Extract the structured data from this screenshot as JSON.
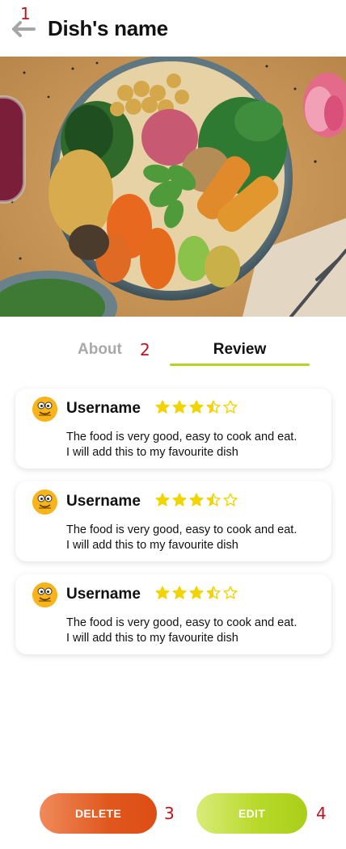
{
  "annotations": [
    "1",
    "2",
    "3",
    "4"
  ],
  "header": {
    "title": "Dish's name",
    "back_icon": "arrow-left-icon"
  },
  "hero": {
    "description_icon": "food-bowl-image"
  },
  "tabs": [
    {
      "label": "About",
      "active": false
    },
    {
      "label": "Review",
      "active": true
    }
  ],
  "colors": {
    "accent_green": "#b7d321",
    "delete_orange": "#e0571c",
    "star_yellow": "#f2d500",
    "annotation_red": "#c0121b"
  },
  "reviews": [
    {
      "username": "Username",
      "rating": 3.5,
      "max_rating": 5,
      "comment_line1": "The food is very good, easy to cook and eat.",
      "comment_line2": "I will add this to my favourite dish"
    },
    {
      "username": "Username",
      "rating": 3.5,
      "max_rating": 5,
      "comment_line1": "The food is very good, easy to cook and eat.",
      "comment_line2": "I will add this to my favourite dish"
    },
    {
      "username": "Username",
      "rating": 3.5,
      "max_rating": 5,
      "comment_line1": "The food is very good, easy to cook and eat.",
      "comment_line2": "I will add this to my favourite dish"
    }
  ],
  "actions": {
    "delete_label": "DELETE",
    "edit_label": "EDIT"
  }
}
